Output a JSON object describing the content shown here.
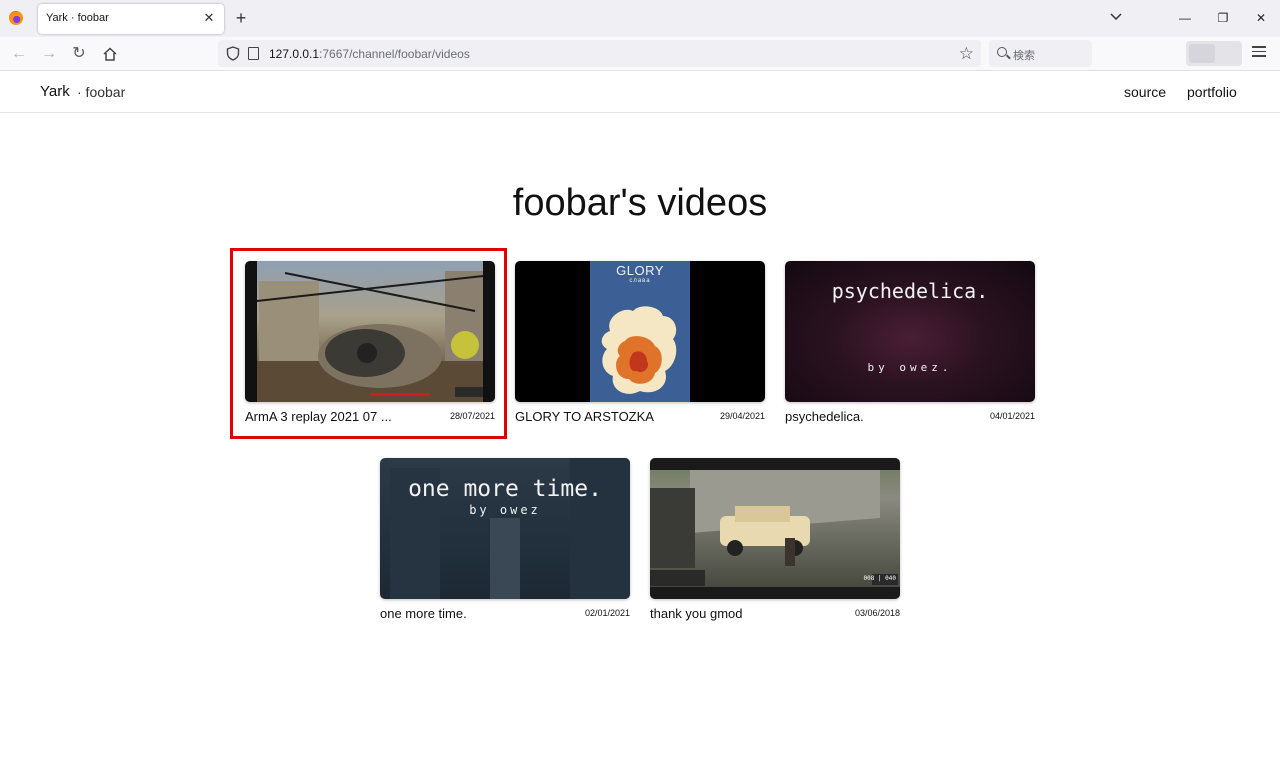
{
  "browser": {
    "tab_title": "Yark · foobar",
    "tab_close": "✕",
    "new_tab": "+",
    "url_host": "127.0.0.1",
    "url_rest": ":7667/channel/foobar/videos",
    "search_placeholder": "検索",
    "window_controls": {
      "minimize": "—",
      "restore": "❐",
      "close": "✕"
    }
  },
  "header": {
    "brand": "Yark",
    "channel": "· foobar",
    "links": [
      "source",
      "portfolio"
    ]
  },
  "page": {
    "title": "foobar's videos"
  },
  "videos": [
    {
      "title": "ArmA 3 replay 2021 07 ...",
      "date": "28/07/2021",
      "highlighted": true
    },
    {
      "title": "GLORY TO ARSTOZKA",
      "date": "29/04/2021",
      "thumb_title": "GLORY",
      "thumb_sub": "слава"
    },
    {
      "title": "psychedelica.",
      "date": "04/01/2021",
      "thumb_title": "psychedelica.",
      "thumb_sub": "by owez."
    },
    {
      "title": "one more time.",
      "date": "02/01/2021",
      "thumb_title": "one more time.",
      "thumb_sub": "by owez"
    },
    {
      "title": "thank you gmod",
      "date": "03/06/2018",
      "thumb_badge": "008 | 040"
    }
  ],
  "colors": {
    "highlight": "#e00000",
    "tab_bg": "#f0f0f4"
  }
}
